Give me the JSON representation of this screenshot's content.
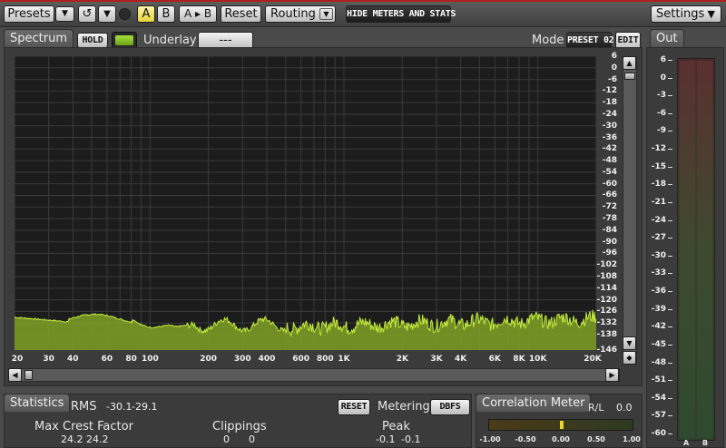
{
  "toolbar": {
    "presets_label": "Presets",
    "a_label": "A",
    "b_label": "B",
    "ab_label": "A ▸ B",
    "reset_label": "Reset",
    "routing_label": "Routing",
    "hide_label": "HIDE METERS AND STATS",
    "settings_label": "Settings"
  },
  "spectrum": {
    "tab_label": "Spectrum",
    "hold_label": "HOLD",
    "underlay_label": "Underlay",
    "underlay_value": "---",
    "mode_label": "Mode",
    "mode_value": "PRESET 02",
    "edit_label": "EDIT",
    "db_ticks": [
      "6",
      "0",
      "-6",
      "-12",
      "-18",
      "-24",
      "-30",
      "-36",
      "-42",
      "-48",
      "-54",
      "-60",
      "-66",
      "-72",
      "-78",
      "-84",
      "-90",
      "-96",
      "-102",
      "-108",
      "-114",
      "-120",
      "-126",
      "-132",
      "-138",
      "-146"
    ],
    "freq_ticks": [
      "20",
      "30",
      "40",
      "60",
      "80",
      "100",
      "200",
      "300",
      "400",
      "600",
      "800",
      "1K",
      "2K",
      "3K",
      "4K",
      "6K",
      "8K",
      "10K",
      "20K"
    ],
    "freq_values": [
      20,
      30,
      40,
      60,
      80,
      100,
      200,
      300,
      400,
      600,
      800,
      1000,
      2000,
      3000,
      4000,
      6000,
      8000,
      10000,
      20000
    ],
    "fill_color": "#7fa226",
    "line_color": "#c6ee3c"
  },
  "out": {
    "tab_label": "Out",
    "ticks": [
      "6",
      "0",
      "-3",
      "-6",
      "-9",
      "-12",
      "-15",
      "-18",
      "-21",
      "-24",
      "-27",
      "-30",
      "-33",
      "-36",
      "-39",
      "-42",
      "-45",
      "-48",
      "-51",
      "-54",
      "-57",
      "-60"
    ],
    "channel_a": "A",
    "channel_b": "B"
  },
  "stats": {
    "tab_label": "Statistics",
    "rms_label": "RMS",
    "rms_l": "-30.1",
    "rms_r": "-29.1",
    "reset_label": "RESET",
    "metering_label": "Metering",
    "metering_value": "DBFS",
    "crest_label": "Max Crest Factor",
    "crest_l": "24.2",
    "crest_r": "24.2",
    "clip_label": "Clippings",
    "clip_l": "0",
    "clip_r": "0",
    "peak_label": "Peak",
    "peak_l": "-0.1",
    "peak_r": "-0.1"
  },
  "correlation": {
    "tab_label": "Correlation Meter",
    "rl_label": "R/L",
    "rl_value": "0.0",
    "scale": [
      "-1.00",
      "-0.50",
      "0.00",
      "0.50",
      "1.00"
    ],
    "value": 0.0
  }
}
